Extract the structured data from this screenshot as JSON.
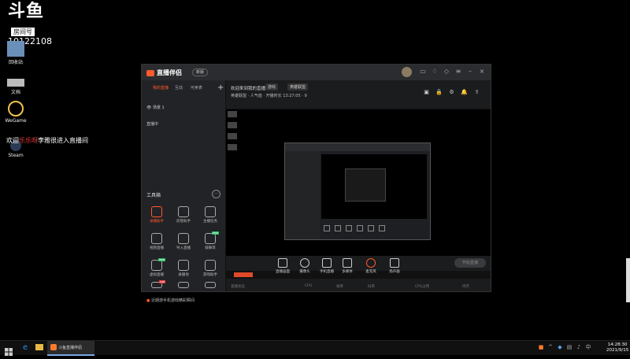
{
  "watermark": {
    "logo": "斗鱼",
    "tag": "房间号",
    "room": "10122108"
  },
  "desktop": {
    "icons": [
      {
        "label": "回收站",
        "icon": "recycle-bin-icon"
      },
      {
        "label": "文档",
        "icon": "drive-icon"
      },
      {
        "label": "WeGame",
        "icon": "wegame-icon"
      },
      {
        "label": "Steam",
        "icon": "steam-icon"
      }
    ],
    "overlay_prefix": "欢迎",
    "overlay_name": "乐乐呀",
    "overlay_suffix": "李雅很进入直播间"
  },
  "app": {
    "name": "直播伴侣",
    "version": "新版",
    "tabs": [
      "我的直播",
      "互动",
      "可卖表"
    ],
    "scene_label": "场景 1",
    "scene_hint": "直播中",
    "toolbox_title": "工具箱",
    "tools": [
      {
        "label": "录播助手",
        "badge": ""
      },
      {
        "label": "房管助手",
        "badge": ""
      },
      {
        "label": "主播任务",
        "badge": ""
      },
      {
        "label": "视频直播",
        "badge": ""
      },
      {
        "label": "导入直播",
        "badge": ""
      },
      {
        "label": "鼓舞等",
        "badge": "new"
      },
      {
        "label": "虚拟直播",
        "badge": "new"
      },
      {
        "label": "录播地",
        "badge": ""
      },
      {
        "label": "游戏助手",
        "badge": ""
      },
      {
        "label": "特效",
        "badge": "hot"
      },
      {
        "label": "下载",
        "badge": ""
      },
      {
        "label": "更多",
        "badge": ""
      }
    ],
    "bottom_tip": "近期游手机游戏精彩瞬间",
    "stream_title": "欢迎来到我的直播间",
    "category_chip": "游戏",
    "edit_chip": "英雄联盟",
    "line2_a": "英雄联盟",
    "line2_b": "人气值",
    "line2_c": "开播时长",
    "line2_time": "13:27:05",
    "line2_viewers": "9",
    "controls": [
      "直播画面",
      "摄像头",
      "手机直播",
      "多媒体",
      "麦克风",
      "扬声器"
    ],
    "start_live": "开始直播",
    "status": [
      "直播状态",
      "CPU",
      "帧率",
      "码率",
      "CPU占用",
      "内存"
    ]
  },
  "taskbar": {
    "app_label": "斗鱼直播伴侣",
    "time": "14:28:30",
    "date": "2021/9/15"
  }
}
